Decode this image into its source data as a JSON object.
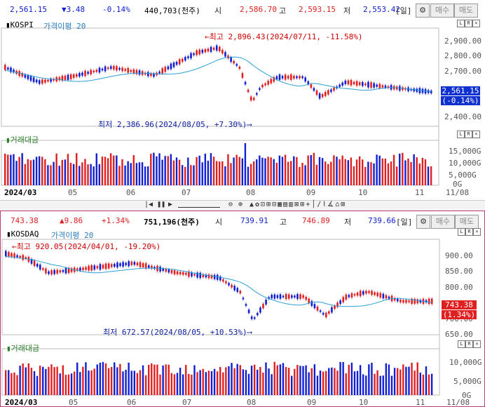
{
  "kospi": {
    "ticker": {
      "price": "2,561.15",
      "change": "▼3.48",
      "pct": "-0.14%",
      "volume": "440,703(천주)",
      "open_label": "시",
      "open": "2,586.70",
      "high_label": "고",
      "high": "2,593.15",
      "low_label": "저",
      "low": "2,553.42",
      "period": "[일]",
      "buy": "매수",
      "sell": "매도"
    },
    "title": "KOSPI",
    "ma_label": "가격이평 20",
    "high_note": "←최고 2,896.43(2024/07/11, -11.58%)",
    "low_note": "최저 2,386.96(2024/08/05, +7.30%)⟶",
    "price_badge": "2,561.15",
    "pct_badge": "(-0.14%)",
    "y_ticks": [
      "2,900.00",
      "2,800.00",
      "2,700.00",
      "2,400.00"
    ],
    "vol_title": "거래대금",
    "vol_ticks": [
      "15,000G",
      "10,000G",
      "5,000G",
      "0G"
    ],
    "x_ticks": [
      "2024/03",
      "05",
      "06",
      "07",
      "08",
      "09",
      "10",
      "11",
      "11/08"
    ]
  },
  "kosdaq": {
    "ticker": {
      "price": "743.38",
      "change": "▲9.86",
      "pct": "+1.34%",
      "volume": "751,196(천주)",
      "open_label": "시",
      "open": "739.91",
      "high_label": "고",
      "high": "746.89",
      "low_label": "저",
      "low": "739.66",
      "period": "[일]",
      "buy": "매수",
      "sell": "매도"
    },
    "title": "KOSDAQ",
    "ma_label": "가격이평 20",
    "high_note": "←최고 920.05(2024/04/01, -19.20%)",
    "low_note": "최저 672.57(2024/08/05, +10.53%)⟶",
    "price_badge": "743.38",
    "pct_badge": "(1.34%)",
    "y_ticks": [
      "900.00",
      "850.00",
      "800.00",
      "700.00",
      "650.00"
    ],
    "vol_title": "거래대금",
    "vol_ticks": [
      "10,000G",
      "5,000G",
      "0G"
    ],
    "x_ticks": [
      "2024/03",
      "05",
      "06",
      "07",
      "08",
      "09",
      "10",
      "11",
      "11/08"
    ]
  },
  "colors": {
    "up": "#e02020",
    "down": "#1020d0",
    "ma": "#2a9fd6",
    "accent": "#c0397a"
  },
  "icons": [
    "gear-icon",
    "zoom-out-icon",
    "zoom-in-icon",
    "play-icon",
    "pause-icon",
    "first-icon"
  ]
}
